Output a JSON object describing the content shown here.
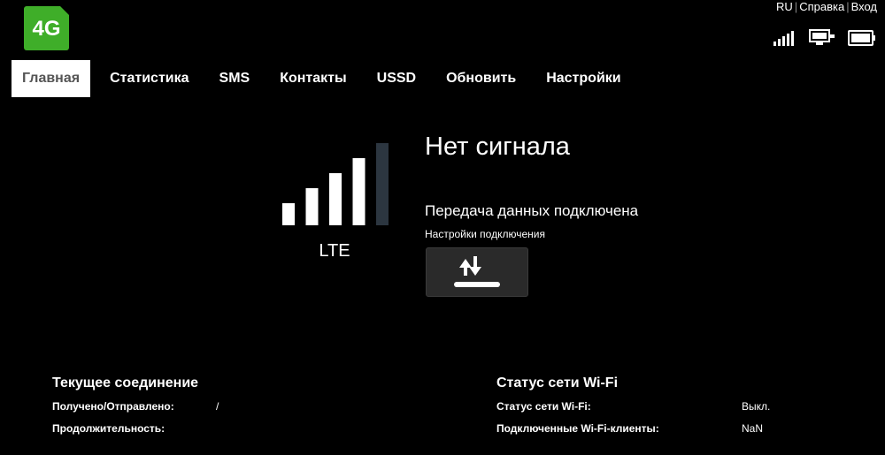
{
  "logo": {
    "text": "4G",
    "color": "#3fae29"
  },
  "toplinks": {
    "lang": "RU",
    "help": "Справка",
    "login": "Вход"
  },
  "status_icons": [
    "signal-strength-icon",
    "monitor-icon",
    "battery-icon"
  ],
  "nav": {
    "items": [
      {
        "label": "Главная",
        "active": true
      },
      {
        "label": "Статистика"
      },
      {
        "label": "SMS"
      },
      {
        "label": "Контакты"
      },
      {
        "label": "USSD"
      },
      {
        "label": "Обновить"
      },
      {
        "label": "Настройки"
      }
    ]
  },
  "signal": {
    "bars_total": 5,
    "bars_filled": 4,
    "network_type": "LTE",
    "status": "Нет сигнала"
  },
  "connection": {
    "data_status": "Передача данных подключена",
    "settings_label": "Настройки подключения",
    "button_icon": "upload-download-icon"
  },
  "current_connection": {
    "title": "Текущее соединение",
    "received_sent_label": "Получено/Отправлено:",
    "received_sent_value": "/",
    "duration_label": "Продолжительность:",
    "duration_value": ""
  },
  "wifi_status": {
    "title": "Статус сети Wi-Fi",
    "status_label": "Статус сети Wi-Fi:",
    "status_value": "Выкл.",
    "clients_label": "Подключенные Wi-Fi-клиенты:",
    "clients_value": "NaN"
  },
  "colors": {
    "background": "#000000",
    "text": "#ffffff",
    "bar_inactive": "#2c3640",
    "button_bg": "#2a2a2a"
  }
}
